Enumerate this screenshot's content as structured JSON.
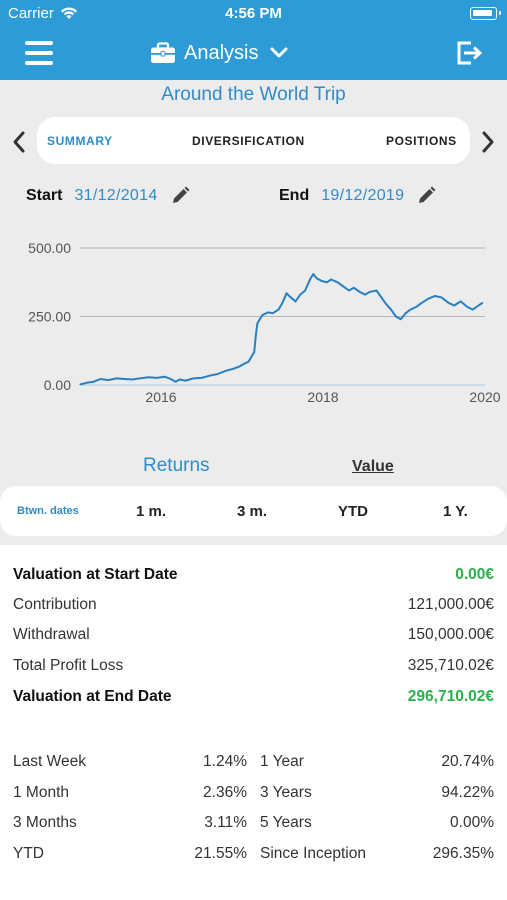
{
  "status": {
    "carrier": "Carrier",
    "time": "4:56 PM"
  },
  "nav": {
    "title": "Analysis"
  },
  "portfolio_name": "Around the World Trip",
  "tabs": [
    "SUMMARY",
    "DIVERSIFICATION",
    "POSITIONS"
  ],
  "dates": {
    "start_label": "Start",
    "start_value": "31/12/2014",
    "end_label": "End",
    "end_value": "19/12/2019"
  },
  "chart_data": {
    "type": "line",
    "y_ticks": [
      "500.00",
      "250.00",
      "0.00"
    ],
    "x_ticks": [
      "2016",
      "2018",
      "2020"
    ],
    "ylim": [
      0,
      500
    ],
    "xlim": [
      2015.0,
      2020.0
    ],
    "grid": true,
    "series": [
      {
        "color": "#2a7fc1",
        "points": [
          [
            2015.0,
            2
          ],
          [
            2015.08,
            8
          ],
          [
            2015.17,
            12
          ],
          [
            2015.25,
            22
          ],
          [
            2015.35,
            18
          ],
          [
            2015.45,
            24
          ],
          [
            2015.55,
            22
          ],
          [
            2015.65,
            20
          ],
          [
            2015.75,
            25
          ],
          [
            2015.85,
            28
          ],
          [
            2015.95,
            26
          ],
          [
            2016.05,
            30
          ],
          [
            2016.12,
            22
          ],
          [
            2016.18,
            12
          ],
          [
            2016.23,
            20
          ],
          [
            2016.3,
            16
          ],
          [
            2016.4,
            24
          ],
          [
            2016.5,
            26
          ],
          [
            2016.6,
            34
          ],
          [
            2016.7,
            40
          ],
          [
            2016.8,
            52
          ],
          [
            2016.9,
            60
          ],
          [
            2016.97,
            68
          ],
          [
            2017.03,
            78
          ],
          [
            2017.08,
            85
          ],
          [
            2017.13,
            110
          ],
          [
            2017.15,
            120
          ],
          [
            2017.17,
            180
          ],
          [
            2017.19,
            225
          ],
          [
            2017.25,
            255
          ],
          [
            2017.32,
            265
          ],
          [
            2017.38,
            262
          ],
          [
            2017.45,
            275
          ],
          [
            2017.5,
            300
          ],
          [
            2017.55,
            335
          ],
          [
            2017.6,
            320
          ],
          [
            2017.66,
            305
          ],
          [
            2017.72,
            330
          ],
          [
            2017.78,
            345
          ],
          [
            2017.84,
            385
          ],
          [
            2017.88,
            405
          ],
          [
            2017.92,
            390
          ],
          [
            2017.98,
            380
          ],
          [
            2018.05,
            375
          ],
          [
            2018.1,
            385
          ],
          [
            2018.18,
            375
          ],
          [
            2018.25,
            360
          ],
          [
            2018.32,
            345
          ],
          [
            2018.38,
            355
          ],
          [
            2018.45,
            340
          ],
          [
            2018.52,
            330
          ],
          [
            2018.58,
            340
          ],
          [
            2018.66,
            345
          ],
          [
            2018.72,
            320
          ],
          [
            2018.78,
            295
          ],
          [
            2018.84,
            275
          ],
          [
            2018.9,
            250
          ],
          [
            2018.96,
            240
          ],
          [
            2019.02,
            262
          ],
          [
            2019.08,
            275
          ],
          [
            2019.15,
            285
          ],
          [
            2019.22,
            300
          ],
          [
            2019.3,
            315
          ],
          [
            2019.38,
            325
          ],
          [
            2019.46,
            320
          ],
          [
            2019.55,
            300
          ],
          [
            2019.62,
            290
          ],
          [
            2019.7,
            305
          ],
          [
            2019.78,
            285
          ],
          [
            2019.85,
            275
          ],
          [
            2019.92,
            290
          ],
          [
            2019.97,
            300
          ]
        ]
      }
    ]
  },
  "toggle": {
    "returns": "Returns",
    "value": "Value"
  },
  "periods": [
    "Btwn. dates",
    "1 m.",
    "3 m.",
    "YTD",
    "1 Y."
  ],
  "valuation": [
    {
      "label": "Valuation at Start Date",
      "value": "0.00€",
      "bold": true,
      "color": "green"
    },
    {
      "label": "Contribution",
      "value": "121,000.00€",
      "bold": false,
      "color": "plain"
    },
    {
      "label": "Withdrawal",
      "value": "150,000.00€",
      "bold": false,
      "color": "plain"
    },
    {
      "label": "Total Profit Loss",
      "value": "325,710.02€",
      "bold": false,
      "color": "plain"
    },
    {
      "label": "Valuation at End Date",
      "value": "296,710.02€",
      "bold": true,
      "color": "green"
    }
  ],
  "returns_left": [
    {
      "label": "Last Week",
      "value": "1.24%",
      "color": "green"
    },
    {
      "label": "1 Month",
      "value": "2.36%",
      "color": "green"
    },
    {
      "label": "3 Months",
      "value": "3.11%",
      "color": "green"
    },
    {
      "label": "YTD",
      "value": "21.55%",
      "color": "green"
    }
  ],
  "returns_right": [
    {
      "label": "1 Year",
      "value": "20.74%",
      "color": "green"
    },
    {
      "label": "3 Years",
      "value": "94.22%",
      "color": "green"
    },
    {
      "label": "5 Years",
      "value": "0.00%",
      "color": "red"
    },
    {
      "label": "Since Inception",
      "value": "296.35%",
      "color": "green"
    }
  ]
}
